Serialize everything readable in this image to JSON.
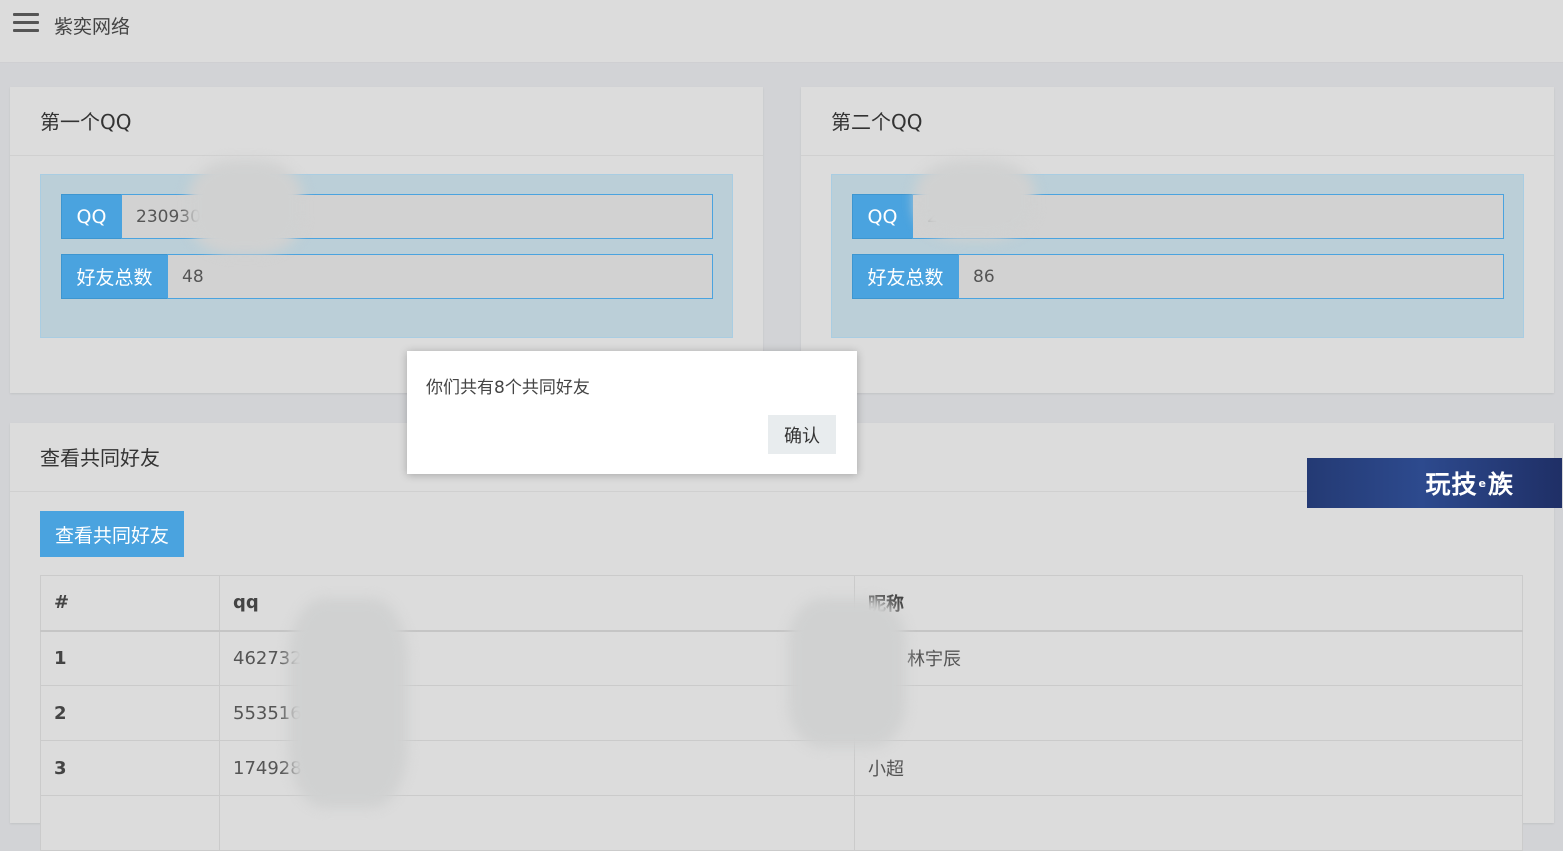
{
  "header": {
    "brand": "紫奕网络",
    "menu_icon": "hamburger-menu-icon"
  },
  "panel1": {
    "title": "第一个QQ",
    "qq_label": "QQ",
    "qq_value": "2309300",
    "friends_label": "好友总数",
    "friends_value": "48"
  },
  "panel2": {
    "title": "第二个QQ",
    "qq_label": "QQ",
    "qq_value": "2        925",
    "friends_label": "好友总数",
    "friends_value": "86"
  },
  "common": {
    "title": "查看共同好友",
    "button": "查看共同好友",
    "columns": [
      "#",
      "qq",
      "昵称"
    ],
    "rows": [
      {
        "num": "1",
        "qq": "462732",
        "nick": "林宇辰"
      },
      {
        "num": "2",
        "qq": "553516",
        "nick": ""
      },
      {
        "num": "3",
        "qq": "174928",
        "nick": "小超"
      }
    ]
  },
  "dialog": {
    "message": "你们共有8个共同好友",
    "confirm": "确认"
  },
  "ad": {
    "text_a": "玩技",
    "text_mini": "e",
    "text_b": "族",
    "bg_color": "#243a74"
  }
}
